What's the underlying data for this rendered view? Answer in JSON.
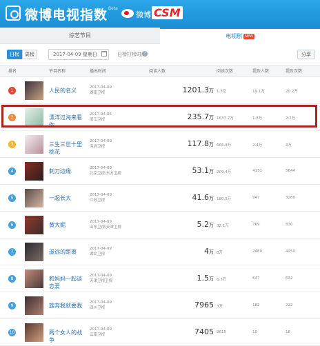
{
  "header": {
    "title": "微博电视指数",
    "beta": "Beta",
    "weibo": "微博",
    "csm": "CSM"
  },
  "tabs": {
    "variety": "综艺节目",
    "tv": "电视剧",
    "new_badge": "NEW"
  },
  "toolbar": {
    "day": "日榜",
    "week": "周榜",
    "date": "2017-04-09  星期日",
    "ts_label": "日榜打榜时间",
    "help": "?",
    "share": "分享"
  },
  "columns": {
    "rank": "排名",
    "name": "节目名称",
    "time": "播出时间",
    "viewers": "阅读人数",
    "reads": "阅读次数",
    "posters": "提及人数",
    "mentions": "提及次数"
  },
  "rows": [
    {
      "rank": "1",
      "name": "人民的名义",
      "date": "2017-04-09",
      "channel": "湖南卫视",
      "viewers": "1201.3",
      "unit": "万",
      "reads": "1.3亿",
      "posters": "19.1万",
      "mentions": "20.2万",
      "color": "#e0453a"
    },
    {
      "rank": "2",
      "name": "漂洋过海来看你",
      "date": "2017-04-06",
      "channel": "浙江卫视",
      "viewers": "235.7",
      "unit": "万",
      "reads": "1637.7万",
      "posters": "1.8万",
      "mentions": "2.7万",
      "color": "#ee8a3a"
    },
    {
      "rank": "3",
      "name": "三生三世十里桃花",
      "date": "2017-04-09",
      "channel": "深圳卫视",
      "viewers": "117.8",
      "unit": "万",
      "reads": "666.3万",
      "posters": "2.4万",
      "mentions": "3万",
      "color": "#f0b730"
    },
    {
      "rank": "4",
      "name": "刺刀边缘",
      "date": "2017-04-09",
      "channel": "北京卫视/东方卫视",
      "viewers": "53.1",
      "unit": "万",
      "reads": "209.4万",
      "posters": "4131",
      "mentions": "5644",
      "color": "#46a0dc"
    },
    {
      "rank": "5",
      "name": "一起长大",
      "date": "2017-04-09",
      "channel": "江苏卫视",
      "viewers": "41.6",
      "unit": "万",
      "reads": "180.5万",
      "posters": "947",
      "mentions": "3280",
      "color": "#46a0dc"
    },
    {
      "rank": "6",
      "name": "黄大妮",
      "date": "2017-04-09",
      "channel": "山东卫视/天津卫视",
      "viewers": "5.2",
      "unit": "万",
      "reads": "32.1万",
      "posters": "769",
      "mentions": "830",
      "color": "#46a0dc"
    },
    {
      "rank": "7",
      "name": "遥远的距离",
      "date": "2017-04-09",
      "channel": "湖北卫视",
      "viewers": "4",
      "unit": "万",
      "reads": "8万",
      "posters": "2489",
      "mentions": "4250",
      "color": "#46a0dc"
    },
    {
      "rank": "8",
      "name": "和妈妈一起谈恋爱",
      "date": "2017-04-09",
      "channel": "天津卫视卫视",
      "viewers": "1.5",
      "unit": "万",
      "reads": "6.3万",
      "posters": "547",
      "mentions": "632",
      "color": "#46a0dc"
    },
    {
      "rank": "9",
      "name": "旋奔我就要我",
      "date": "2017-04-09",
      "channel": "四川卫视",
      "viewers": "7965",
      "unit": "",
      "reads": "3万",
      "posters": "182",
      "mentions": "222",
      "color": "#46a0dc"
    },
    {
      "rank": "10",
      "name": "两个女人的战争",
      "date": "2017-04-09",
      "channel": "云南卫视",
      "viewers": "7405",
      "unit": "",
      "reads": "9615",
      "posters": "15",
      "mentions": "18",
      "color": "#46a0dc"
    }
  ]
}
